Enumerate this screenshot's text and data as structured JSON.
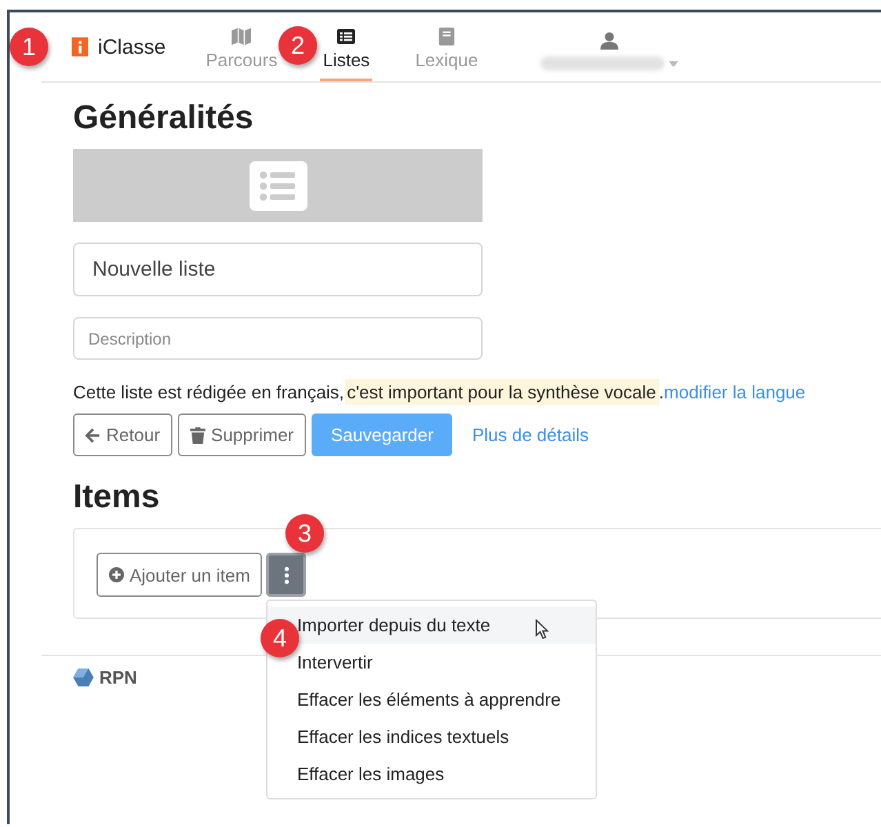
{
  "navbar": {
    "brand": "iClasse",
    "tabs": [
      {
        "label": "Parcours",
        "selected": false
      },
      {
        "label": "Listes",
        "selected": true
      },
      {
        "label": "Lexique",
        "selected": false
      }
    ]
  },
  "general": {
    "heading": "Généralités",
    "title_value": "Nouvelle liste",
    "description_placeholder": "Description",
    "language_text": "Cette liste est rédigée en français,",
    "language_note": "c'est important pour la synthèse vocale",
    "language_period": ".",
    "language_link": "modifier la langue"
  },
  "buttons": [
    {
      "label": "Retour",
      "kind": "back"
    },
    {
      "label": "Supprimer",
      "kind": "delete"
    },
    {
      "label": "Sauvegarder",
      "kind": "primary"
    },
    {
      "label": "Plus de détails",
      "kind": "link"
    }
  ],
  "items": {
    "heading": "Items",
    "add_button": "Ajouter un item",
    "menu": [
      {
        "label": "Importer depuis du texte",
        "selected": true
      },
      {
        "label": "Intervertir",
        "selected": false
      },
      {
        "label": "Effacer les éléments à apprendre",
        "selected": false
      },
      {
        "label": "Effacer les indices textuels",
        "selected": false
      },
      {
        "label": "Effacer les images",
        "selected": false
      }
    ]
  },
  "footer": {
    "brand": "RPN"
  },
  "callouts": [
    "1",
    "2",
    "3",
    "4"
  ]
}
